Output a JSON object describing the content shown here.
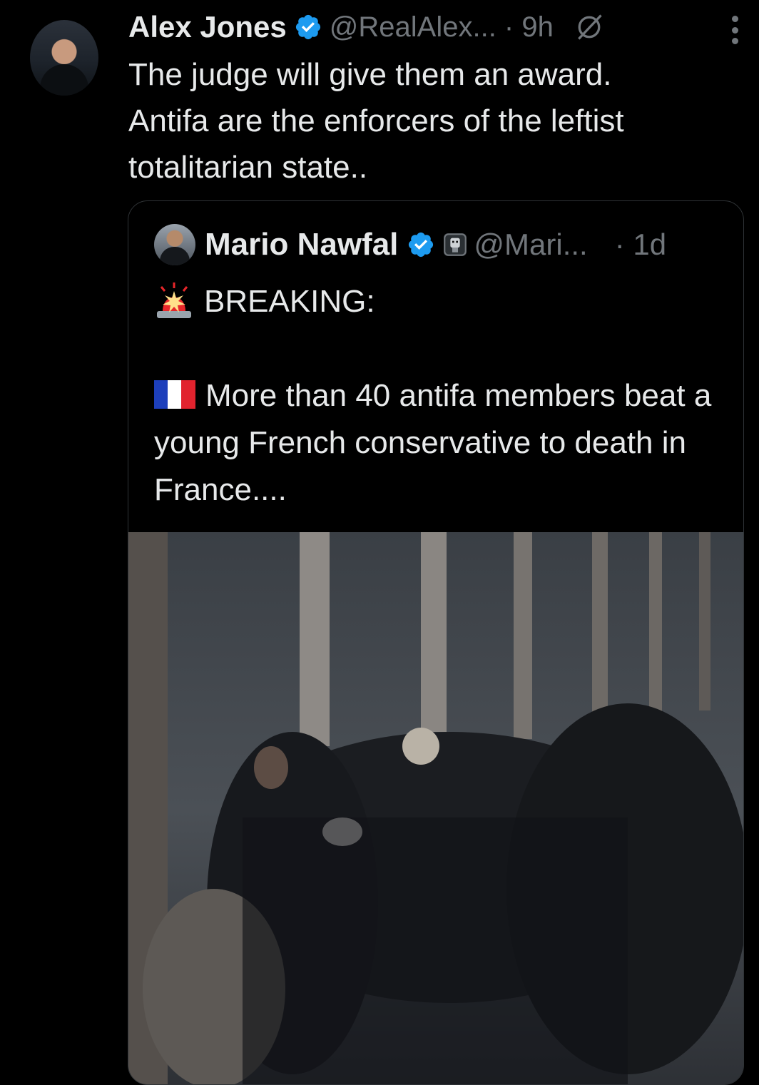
{
  "tweet": {
    "author_name": "Alex Jones",
    "handle_time": "@RealAlex... · 9h",
    "text": "The judge will give them an award.\nAntifa are the enforcers of the leftist totalitarian state..",
    "icons": [
      "verified-badge-icon",
      "grok-icon",
      "more-options-icon"
    ],
    "colors": {
      "background": "#000000",
      "text": "#e7e9ea",
      "secondary": "#71767b",
      "verified": "#1d9bf0"
    }
  },
  "quoted_tweet": {
    "author_name": "Mario Nawfal",
    "handle": "@Mari...",
    "time": "· 1d",
    "breaking": "BREAKING:",
    "body": "More than 40 antifa members beat a young French conservative to death in France....",
    "icons": [
      "rotating-light-emoji",
      "french-flag-emoji",
      "verified-badge-icon",
      "affiliate-badge-icon"
    ],
    "media": "video still of a crowd scuffle in front of a concrete wall"
  }
}
